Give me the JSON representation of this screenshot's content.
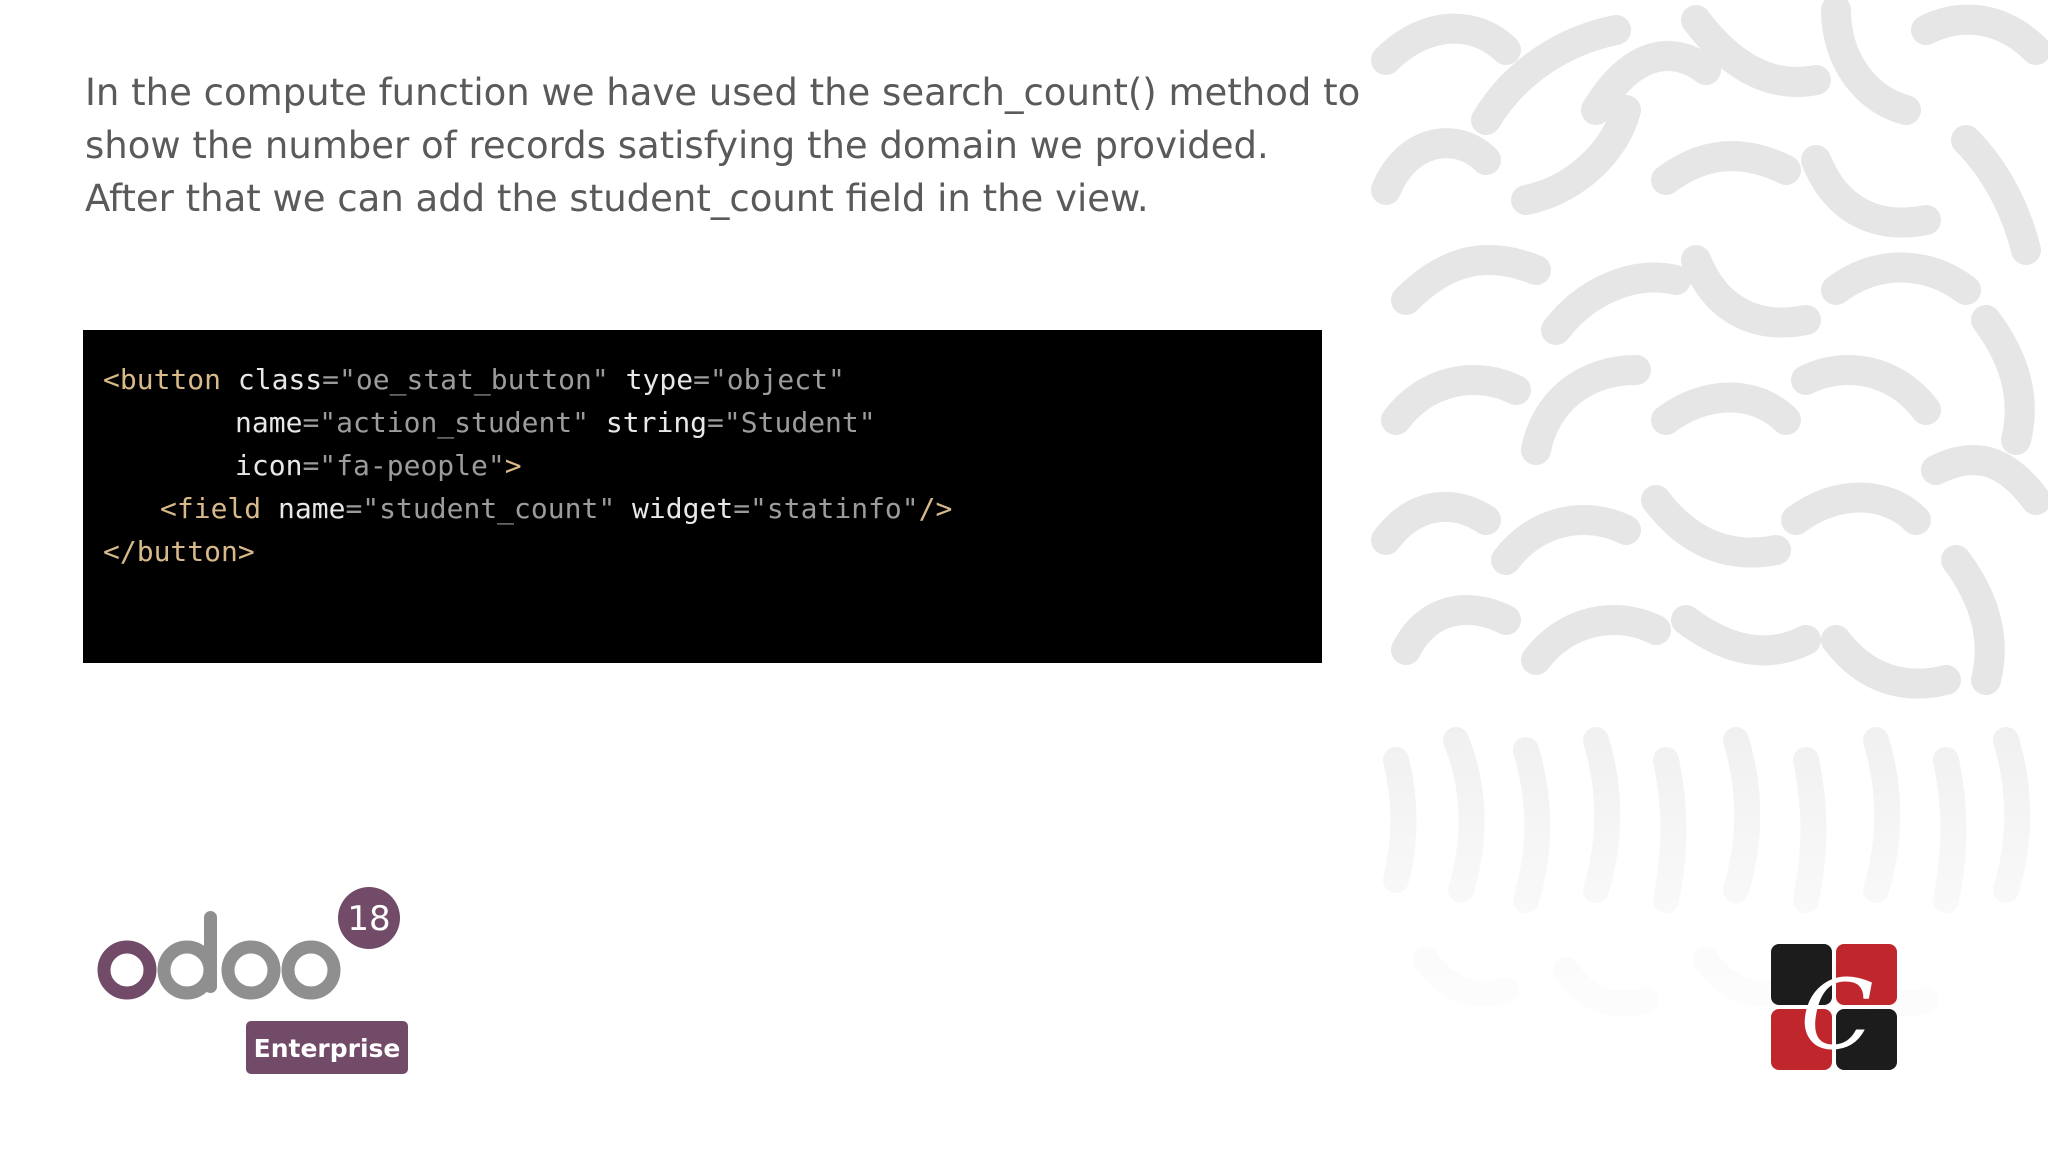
{
  "paragraph": {
    "line1": "In the compute function we have used the search_count() method to",
    "line2": "show the number of records satisfying the domain we provided.",
    "line3": "After that we can add the student_count field in the view."
  },
  "code": {
    "line1": {
      "tag_open": "<button",
      "attr1": " class",
      "eq1": "=\"",
      "val1": "oe_stat_button",
      "q1": "\"",
      "attr2": " type",
      "eq2": "=\"",
      "val2": "object",
      "q2": "\""
    },
    "line2": {
      "attr1": "name",
      "eq1": "=\"",
      "val1": "action_student",
      "q1": "\"",
      "attr2": " string",
      "eq2": "=\"",
      "val2": "Student",
      "q2": "\""
    },
    "line3": {
      "attr1": "icon",
      "eq1": "=\"",
      "val1": "fa-people",
      "q1": "\"",
      "end": ">"
    },
    "line4": {
      "tag_open": "<field",
      "attr1": " name",
      "eq1": "=\"",
      "val1": "student_count",
      "q1": "\"",
      "attr2": " widget",
      "eq2": "=\"",
      "val2": "statinfo",
      "q2": "\"",
      "end": "/>"
    },
    "line5": {
      "tag_close": "</button>"
    }
  },
  "odoo_logo": {
    "wordmark": "odoo",
    "version_badge": "18",
    "edition_badge": "Enterprise",
    "purple": "#714b67",
    "gray": "#8f8f8f"
  },
  "company_logo": {
    "icon": "cybrosys-logo",
    "monogram": "C",
    "red": "#c0272d",
    "black": "#1c1c1c"
  },
  "colors": {
    "text": "#5a5a5a",
    "code_bg": "#000000",
    "code_tag": "#d8b98a",
    "pattern": "#e4e4e4"
  }
}
